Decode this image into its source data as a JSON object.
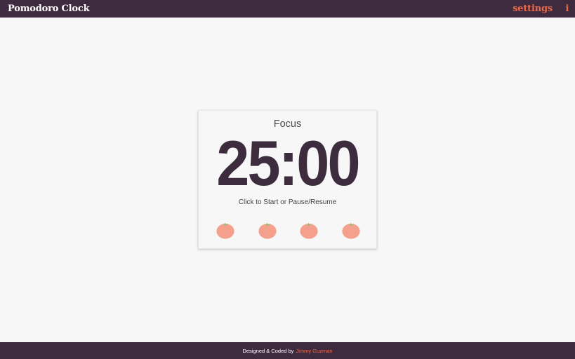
{
  "app": {
    "title": "Pomodoro Clock"
  },
  "nav": {
    "settings_label": "settings",
    "info_label": "i"
  },
  "timer": {
    "mode": "Focus",
    "time": "25:00",
    "hint": "Click to Start or Pause/Resume",
    "sessions": [
      {
        "icon": "tomato-icon",
        "completed": false
      },
      {
        "icon": "tomato-icon",
        "completed": false
      },
      {
        "icon": "tomato-icon",
        "completed": false
      },
      {
        "icon": "tomato-icon",
        "completed": false
      }
    ]
  },
  "footer": {
    "credit": "Designed & Coded by",
    "author": "Jimmy Guzman"
  },
  "colors": {
    "bar": "#3f2b3f",
    "accent": "#e96a4a",
    "timer": "#3d2c3e",
    "tomato": "#f4a08c",
    "leaf": "#8dc07a",
    "background": "#f7f7f7"
  }
}
